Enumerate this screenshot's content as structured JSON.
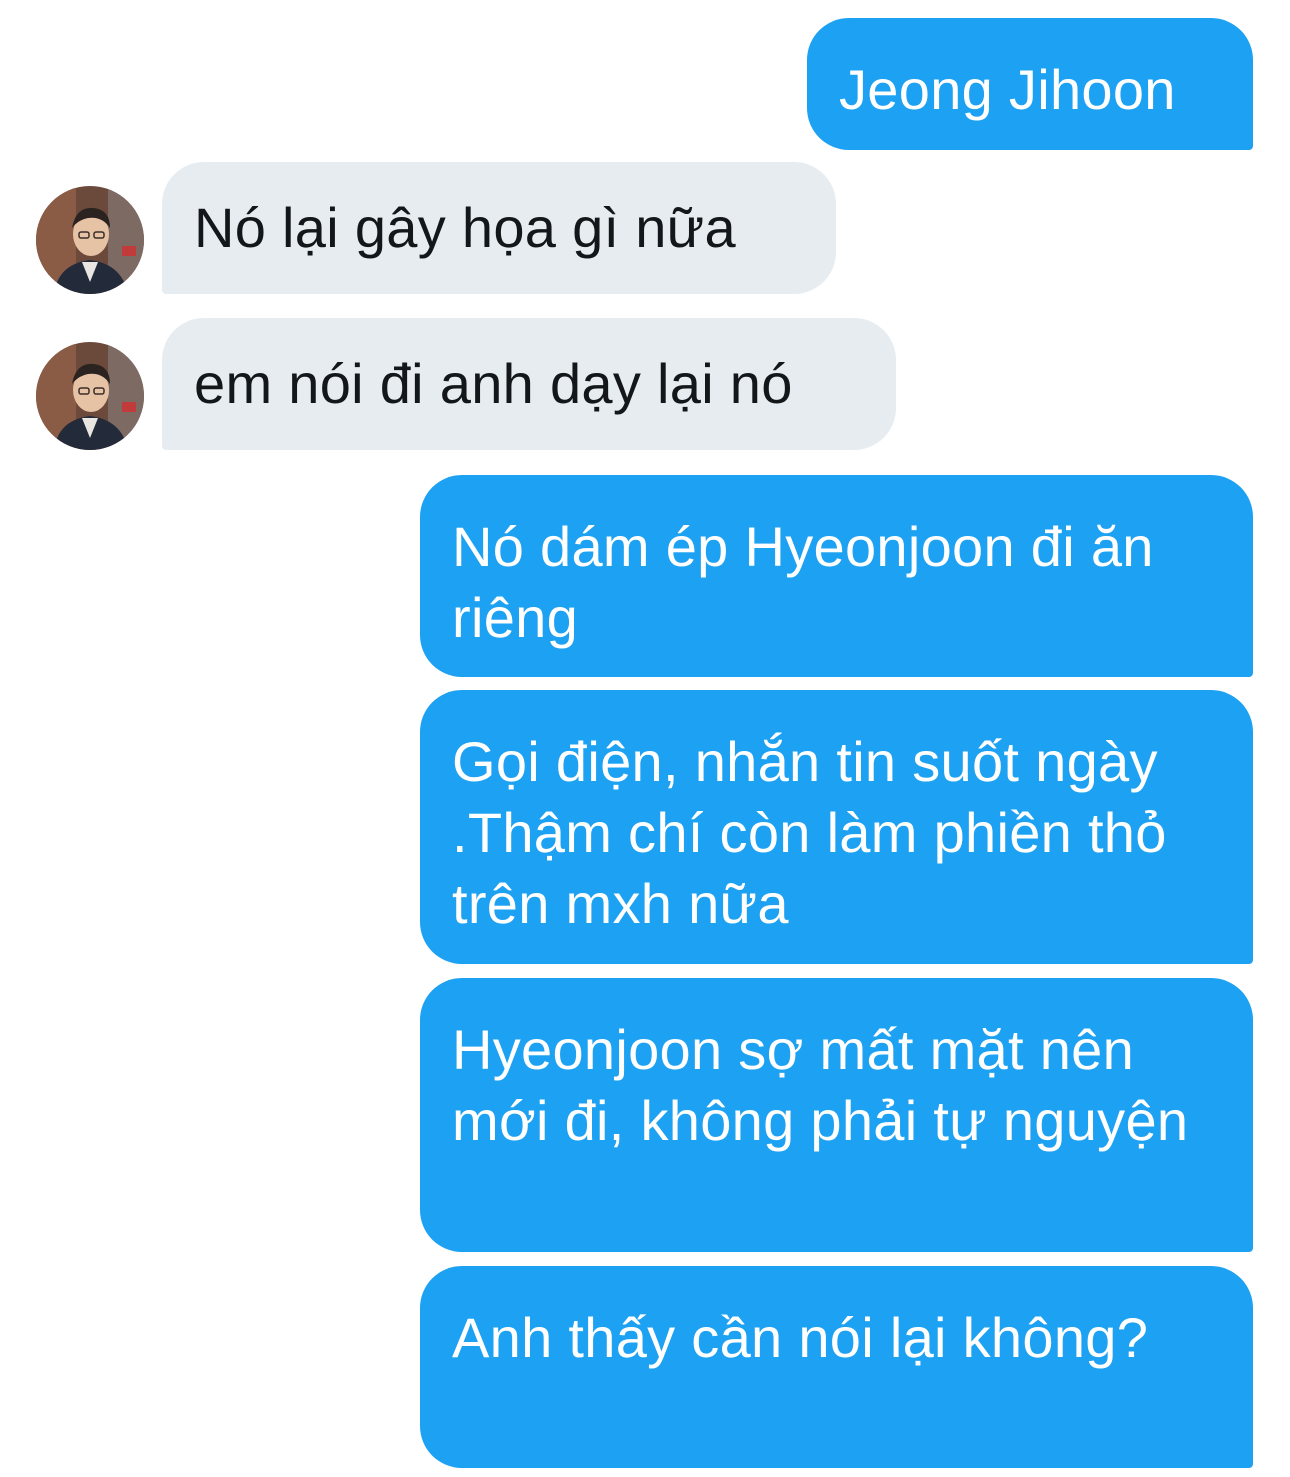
{
  "messages": [
    {
      "direction": "outgoing",
      "text": "Jeong Jihoon"
    },
    {
      "direction": "incoming",
      "text": "Nó lại gây họa gì nữa",
      "avatar": "user-avatar"
    },
    {
      "direction": "incoming",
      "text": "em nói đi anh dạy lại nó",
      "avatar": "user-avatar"
    },
    {
      "direction": "outgoing",
      "text": "Nó dám ép Hyeonjoon đi ăn riêng"
    },
    {
      "direction": "outgoing",
      "text": "Gọi điện, nhắn tin suốt ngày .Thậm chí còn làm phiền thỏ trên mxh nữa"
    },
    {
      "direction": "outgoing",
      "text": "Hyeonjoon sợ mất mặt nên mới đi, không phải tự nguyện"
    },
    {
      "direction": "outgoing",
      "text": "Anh thấy cần nói lại không?"
    }
  ],
  "colors": {
    "outgoing_bubble": "#1da1f2",
    "incoming_bubble": "#e6ecf0",
    "outgoing_text": "#ffffff",
    "incoming_text": "#14171a"
  }
}
